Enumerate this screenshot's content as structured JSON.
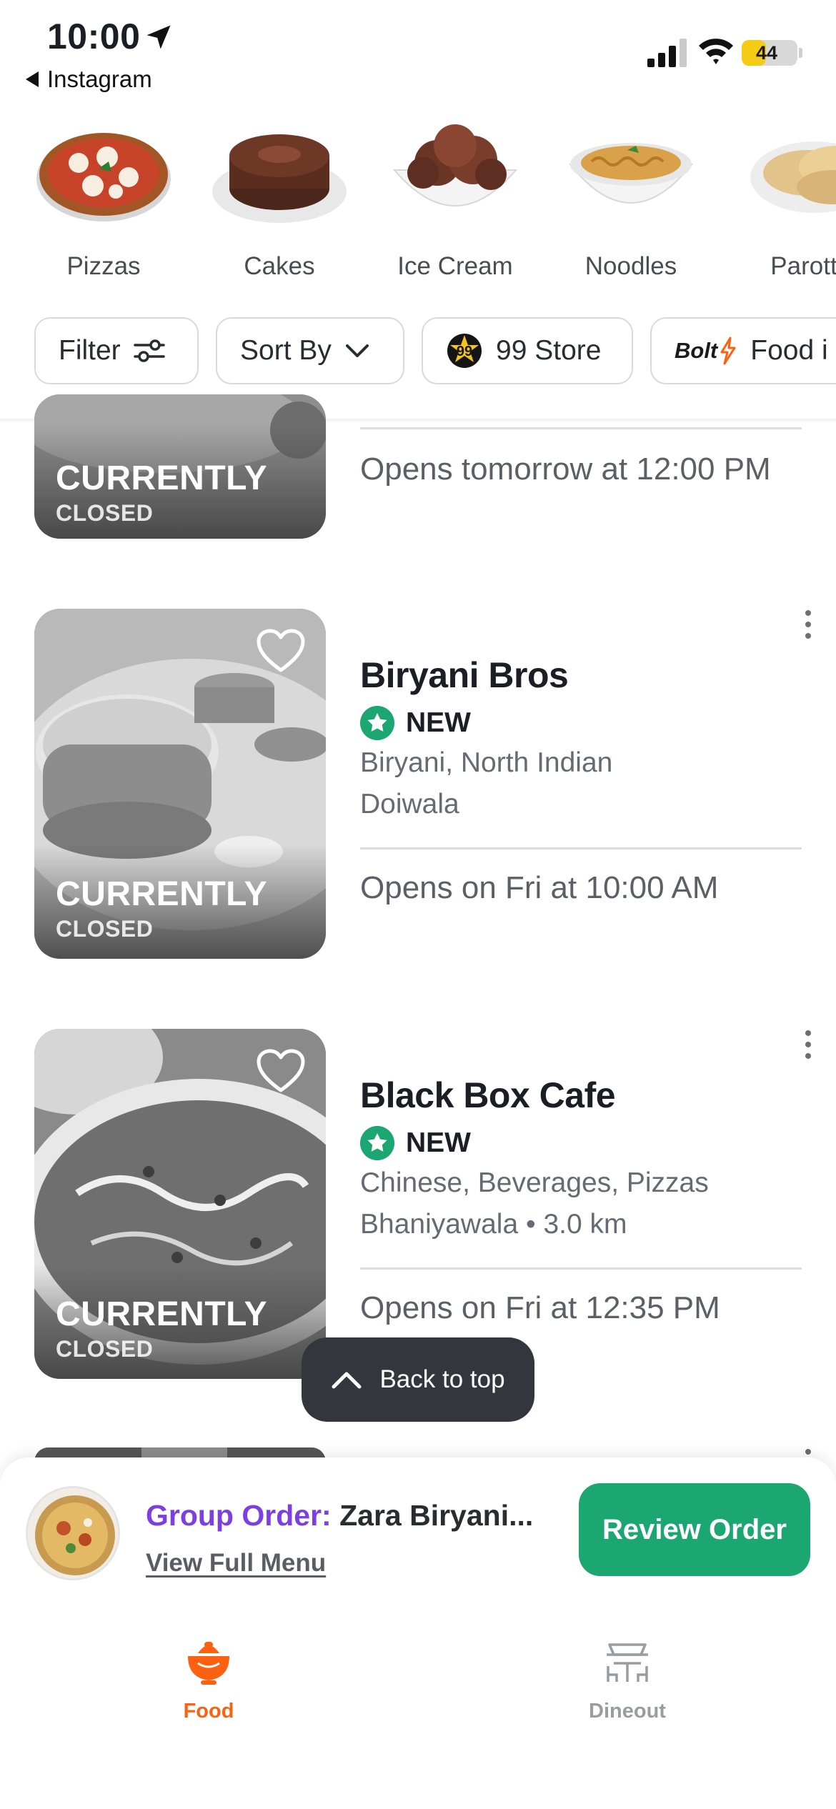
{
  "status_bar": {
    "time": "10:00",
    "back_app": "Instagram",
    "battery": "44",
    "battery_level": 0.44
  },
  "categories": [
    {
      "label": "Pizzas",
      "icon": "pizza-image"
    },
    {
      "label": "Cakes",
      "icon": "cake-image"
    },
    {
      "label": "Ice Cream",
      "icon": "ice-cream-image"
    },
    {
      "label": "Noodles",
      "icon": "noodles-image"
    },
    {
      "label": "Parott",
      "icon": "parotta-image"
    }
  ],
  "filters": {
    "filter": "Filter",
    "sort": "Sort By",
    "store": "99 Store",
    "bolt_logo": "Bolt",
    "bolt": "Food i"
  },
  "restaurants": [
    {
      "closed_line1": "CURRENTLY",
      "closed_line2": "CLOSED",
      "opens": "Opens tomorrow at 12:00 PM"
    },
    {
      "name": "Biryani Bros",
      "badge": "NEW",
      "cuisine": "Biryani, North Indian",
      "locality": "Doiwala",
      "closed_line1": "CURRENTLY",
      "closed_line2": "CLOSED",
      "opens": "Opens on Fri at 10:00 AM"
    },
    {
      "name": "Black Box Cafe",
      "badge": "NEW",
      "cuisine": "Chinese, Beverages, Pizzas",
      "locality": "Bhaniyawala • 3.0 km",
      "closed_line1": "CURRENTLY",
      "closed_line2": "CLOSED",
      "opens": "Opens on Fri at 12:35 PM"
    }
  ],
  "back_to_top": "Back to top",
  "group_order": {
    "label": "Group Order:",
    "restaurant": "Zara Biryani...",
    "link": "View Full Menu",
    "button": "Review Order"
  },
  "tabs": [
    {
      "label": "Food",
      "active": true,
      "color": "#fc6011"
    },
    {
      "label": "Dineout",
      "active": false,
      "color": "#9a9ca2"
    }
  ],
  "colors": {
    "accent_green": "#1ba672",
    "group_purple": "#7b3fe4",
    "food_orange": "#fc6011"
  }
}
